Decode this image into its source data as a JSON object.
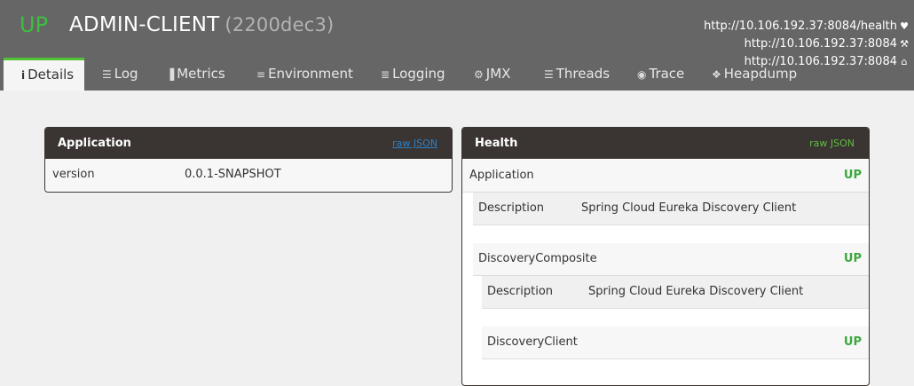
{
  "header": {
    "status": "UP",
    "app_name": "ADMIN-CLIENT",
    "app_version": "(2200dec3)",
    "urls": [
      {
        "text": "http://10.106.192.37:8084/health",
        "icon": "heartbeat-icon",
        "glyph": "♥"
      },
      {
        "text": "http://10.106.192.37:8084",
        "icon": "wrench-icon",
        "glyph": "⚒"
      },
      {
        "text": "http://10.106.192.37:8084",
        "icon": "home-icon",
        "glyph": "⌂"
      }
    ]
  },
  "tabs": [
    {
      "label": "Details",
      "icon": "info-icon",
      "glyph": "i"
    },
    {
      "label": "Log",
      "icon": "file-icon",
      "glyph": "☰"
    },
    {
      "label": "Metrics",
      "icon": "bar-chart-icon",
      "glyph": "▐"
    },
    {
      "label": "Environment",
      "icon": "list-icon",
      "glyph": "≡"
    },
    {
      "label": "Logging",
      "icon": "sliders-icon",
      "glyph": "≣"
    },
    {
      "label": "JMX",
      "icon": "cogs-icon",
      "glyph": "⚙"
    },
    {
      "label": "Threads",
      "icon": "list-icon",
      "glyph": "☰"
    },
    {
      "label": "Trace",
      "icon": "eye-icon",
      "glyph": "◉"
    },
    {
      "label": "Heapdump",
      "icon": "cubes-icon",
      "glyph": "❖"
    }
  ],
  "application_panel": {
    "title": "Application",
    "raw_json": "raw JSON",
    "rows": [
      {
        "key": "version",
        "value": "0.0.1-SNAPSHOT"
      }
    ]
  },
  "health_panel": {
    "title": "Health",
    "raw_json": "raw JSON",
    "application": {
      "label": "Application",
      "status": "UP"
    },
    "app_description": {
      "key": "Description",
      "value": "Spring Cloud Eureka Discovery Client"
    },
    "discovery_composite": {
      "label": "DiscoveryComposite",
      "status": "UP"
    },
    "composite_description": {
      "key": "Description",
      "value": "Spring Cloud Eureka Discovery Client"
    },
    "discovery_client": {
      "label": "DiscoveryClient",
      "status": "UP"
    }
  }
}
